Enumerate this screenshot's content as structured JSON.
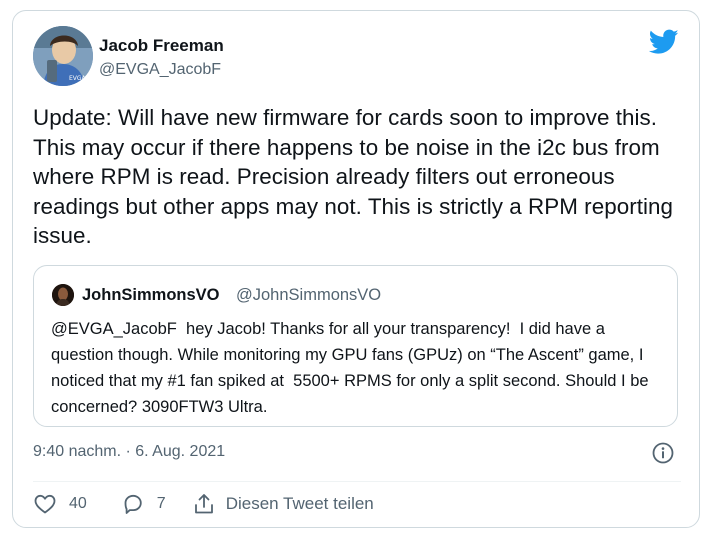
{
  "author": {
    "name": "Jacob Freeman",
    "handle": "@EVGA_JacobF"
  },
  "tweet": {
    "text": "Update: Will have new firmware for cards soon to improve this. This may occur if there happens to be noise in the i2c bus from where RPM is read. Precision already filters out erroneous readings but other apps may not. This is strictly a RPM reporting issue."
  },
  "quote": {
    "name": "JohnSimmonsVO",
    "handle": "@JohnSimmonsVO",
    "text": "@EVGA_JacobF  hey Jacob! Thanks for all your transparency!  I did have a question though. While monitoring my GPU fans (GPUz) on “The Ascent” game, I noticed that my #1 fan spiked at  5500+ RPMS for only a split second. Should I be concerned? 3090FTW3 Ultra."
  },
  "meta": {
    "timestamp": "9:40 nachm. · 6. Aug. 2021"
  },
  "actions": {
    "likes": "40",
    "replies": "7",
    "share_label": "Diesen Tweet teilen"
  },
  "colors": {
    "twitter_blue": "#1d9bf0",
    "text": "#0f1419",
    "secondary": "#536471",
    "border": "#cfd9de"
  },
  "icons": [
    "twitter-logo-icon",
    "info-icon",
    "heart-icon",
    "reply-icon",
    "share-icon"
  ]
}
